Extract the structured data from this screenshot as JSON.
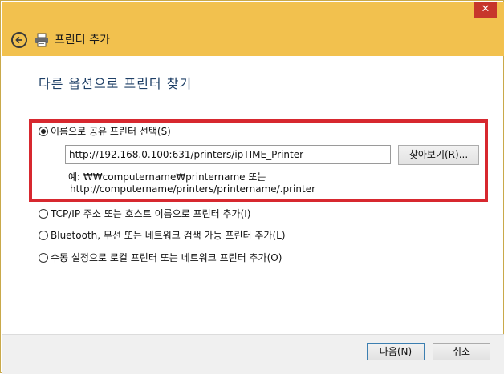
{
  "window": {
    "close_glyph": "✕"
  },
  "header": {
    "title": "프린터 추가"
  },
  "main": {
    "heading": "다른 옵션으로 프린터 찾기",
    "options": [
      {
        "label": "이름으로 공유 프린터 선택(S)",
        "checked": true
      },
      {
        "label": "TCP/IP 주소 또는 호스트 이름으로 프린터 추가(I)",
        "checked": false
      },
      {
        "label": "Bluetooth, 무선 또는 네트워크 검색 가능 프린터 추가(L)",
        "checked": false
      },
      {
        "label": "수동 설정으로 로컬 프린터 또는 네트워크 프린터 추가(O)",
        "checked": false
      }
    ],
    "printer_path": {
      "value": "http://192.168.0.100:631/printers/ipTIME_Printer"
    },
    "browse_label": "찾아보기(R)...",
    "example_line1": "예: ₩₩computername₩printername 또는",
    "example_line2": "http://computername/printers/printername/.printer"
  },
  "footer": {
    "next_label": "다음(N)",
    "cancel_label": "취소"
  },
  "colors": {
    "titlebar": "#f2c14e",
    "highlight": "#d7282f",
    "heading": "#1e3f66",
    "close": "#c7362b"
  }
}
